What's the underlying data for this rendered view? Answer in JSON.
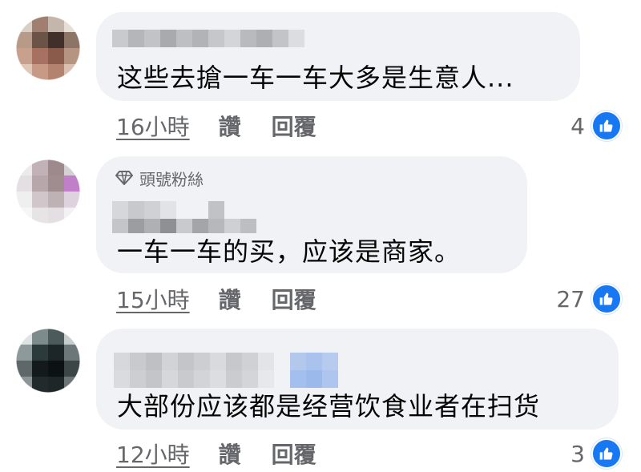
{
  "colors": {
    "bubble": "#f0f2f5",
    "meta": "#65676b",
    "text": "#050505",
    "like": "#1877f2"
  },
  "comments": [
    {
      "text": "这些去搶一车一车大多是生意人...",
      "time": "16小時",
      "like_label": "讚",
      "reply_label": "回覆",
      "reactions": "4"
    },
    {
      "badge": "頭號粉絲",
      "text": "一车一车的买，应该是商家。",
      "time": "15小時",
      "like_label": "讚",
      "reply_label": "回覆",
      "reactions": "27"
    },
    {
      "text": "大部份应该都是经营饮食业者在扫货",
      "time": "12小時",
      "like_label": "讚",
      "reply_label": "回覆",
      "reactions": "3"
    }
  ]
}
